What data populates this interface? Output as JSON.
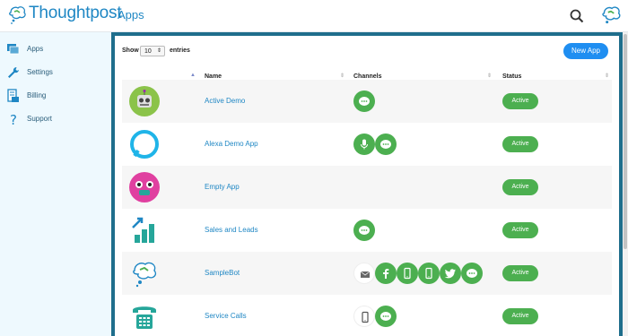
{
  "header": {
    "brand": "Thoughtpost",
    "page_title": "Apps"
  },
  "sidebar": {
    "items": [
      {
        "label": "Apps",
        "icon": "apps-icon"
      },
      {
        "label": "Settings",
        "icon": "wrench-icon"
      },
      {
        "label": "Billing",
        "icon": "billing-icon"
      },
      {
        "label": "Support",
        "icon": "question-icon"
      }
    ]
  },
  "table_controls": {
    "show_label": "Show",
    "entries_value": "10",
    "entries_label": "entries",
    "new_app_label": "New App"
  },
  "columns": {
    "name": "Name",
    "channels": "Channels",
    "status": "Status"
  },
  "rows": [
    {
      "name": "Active Demo",
      "status": "Active",
      "channels": [
        "chat"
      ]
    },
    {
      "name": "Alexa Demo App",
      "status": "Active",
      "channels": [
        "microphone",
        "chat"
      ]
    },
    {
      "name": "Empty App",
      "status": "Active",
      "channels": []
    },
    {
      "name": "Sales and Leads",
      "status": "Active",
      "channels": [
        "chat"
      ]
    },
    {
      "name": "SampleBot",
      "status": "Active",
      "channels": [
        "email",
        "facebook",
        "phone",
        "phone",
        "twitter",
        "chat"
      ]
    },
    {
      "name": "Service Calls",
      "status": "Active",
      "channels": [
        "phone",
        "chat"
      ]
    }
  ],
  "colors": {
    "brand": "#1f87c4",
    "accent_button": "#1f8ef1",
    "status_active": "#4caf50",
    "frame": "#1f6e8c",
    "sidebar_bg": "#eef9fe"
  }
}
